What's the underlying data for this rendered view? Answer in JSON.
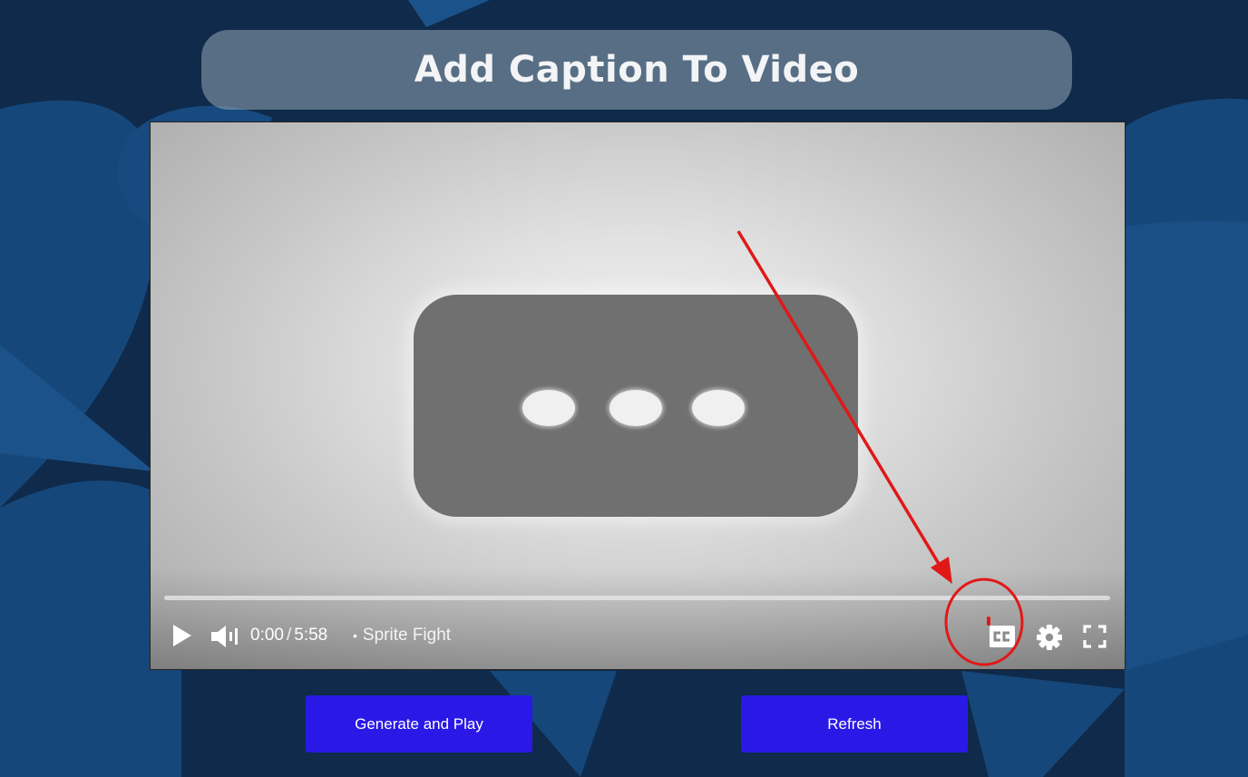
{
  "header": {
    "title": "Add Caption To Video"
  },
  "player": {
    "current_time": "0:00",
    "time_separator": "/",
    "duration": "5:58",
    "title_separator": "•",
    "video_title": "Sprite Fight",
    "progress_fraction": 0,
    "icons": {
      "play": "play-icon",
      "volume": "volume-icon",
      "captions": "closed-captions-icon",
      "settings": "gear-icon",
      "fullscreen": "fullscreen-icon"
    }
  },
  "annotation": {
    "color": "#e01818",
    "arrow_target": "closed-captions-icon"
  },
  "buttons": {
    "generate_label": "Generate and Play",
    "refresh_label": "Refresh",
    "color": "#2a19e6"
  },
  "colors": {
    "background": "#0f2a4a",
    "background_shape": "#16477a"
  }
}
